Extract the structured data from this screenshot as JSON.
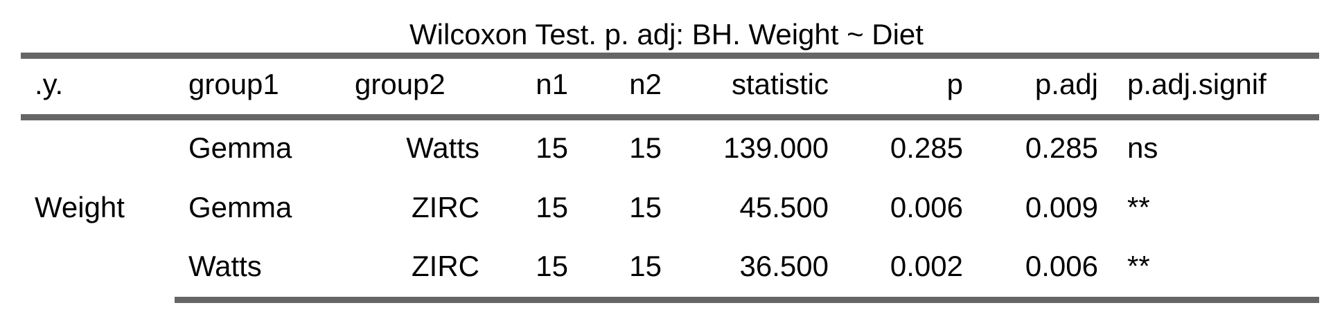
{
  "table": {
    "caption": "Wilcoxon Test. p. adj: BH. Weight ~ Diet",
    "headers": [
      ".y.",
      "group1",
      "group2",
      "n1",
      "n2",
      "statistic",
      "p",
      "p.adj",
      "p.adj.signif"
    ],
    "row_group": "Weight",
    "rows": [
      [
        "Gemma",
        "Watts",
        "15",
        "15",
        "139.000",
        "0.285",
        "0.285",
        "ns"
      ],
      [
        "Gemma",
        "ZIRC",
        "15",
        "15",
        "45.500",
        "0.006",
        "0.009",
        "**"
      ],
      [
        "Watts",
        "ZIRC",
        "15",
        "15",
        "36.500",
        "0.002",
        "0.006",
        "**"
      ]
    ]
  }
}
